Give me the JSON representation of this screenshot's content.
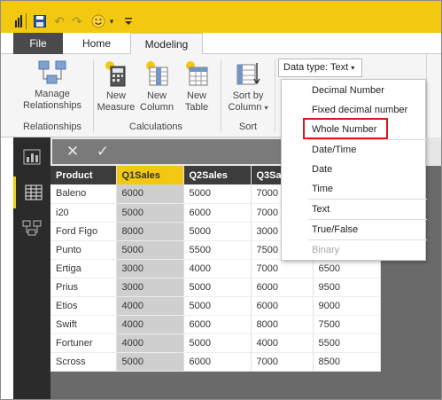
{
  "window": {
    "accent": "#f2c811"
  },
  "tabs": [
    {
      "label": "File"
    },
    {
      "label": "Home"
    },
    {
      "label": "Modeling"
    }
  ],
  "ribbon": {
    "manage_relationships": "Manage Relationships",
    "relationships_group": "Relationships",
    "new_measure": "New Measure",
    "new_column": "New Column",
    "new_table": "New Table",
    "calculations_group": "Calculations",
    "sort_by_column": "Sort by Column",
    "sort_group": "Sort",
    "data_type_label": "Data type: Text"
  },
  "datatype_menu": {
    "items": [
      {
        "label": "Decimal Number"
      },
      {
        "label": "Fixed decimal number"
      },
      {
        "label": "Whole Number"
      },
      {
        "label": "Date/Time"
      },
      {
        "label": "Date"
      },
      {
        "label": "Time"
      },
      {
        "label": "Text"
      },
      {
        "label": "True/False"
      },
      {
        "label": "Binary"
      }
    ],
    "highlighted": "Whole Number"
  },
  "formula_bar": {
    "cancel_icon": "close-icon",
    "commit_icon": "check-icon"
  },
  "grid": {
    "headers": [
      "Product",
      "Q1Sales",
      "Q2Sales",
      "Q3Sales",
      ""
    ],
    "selected_column": "Q1Sales",
    "rows": [
      [
        "Baleno",
        "6000",
        "5000",
        "7000",
        ""
      ],
      [
        "i20",
        "5000",
        "6000",
        "7000",
        ""
      ],
      [
        "Ford Figo",
        "8000",
        "5000",
        "3000",
        ""
      ],
      [
        "Punto",
        "5000",
        "5500",
        "7500",
        ""
      ],
      [
        "Ertiga",
        "3000",
        "4000",
        "7000",
        "6500"
      ],
      [
        "Prius",
        "3000",
        "5000",
        "6000",
        "9500"
      ],
      [
        "Etios",
        "4000",
        "5000",
        "6000",
        "9000"
      ],
      [
        "Swift",
        "4000",
        "6000",
        "8000",
        "7500"
      ],
      [
        "Fortuner",
        "4000",
        "5000",
        "4000",
        "5500"
      ],
      [
        "Scross",
        "5000",
        "6000",
        "7000",
        "8500"
      ]
    ]
  }
}
